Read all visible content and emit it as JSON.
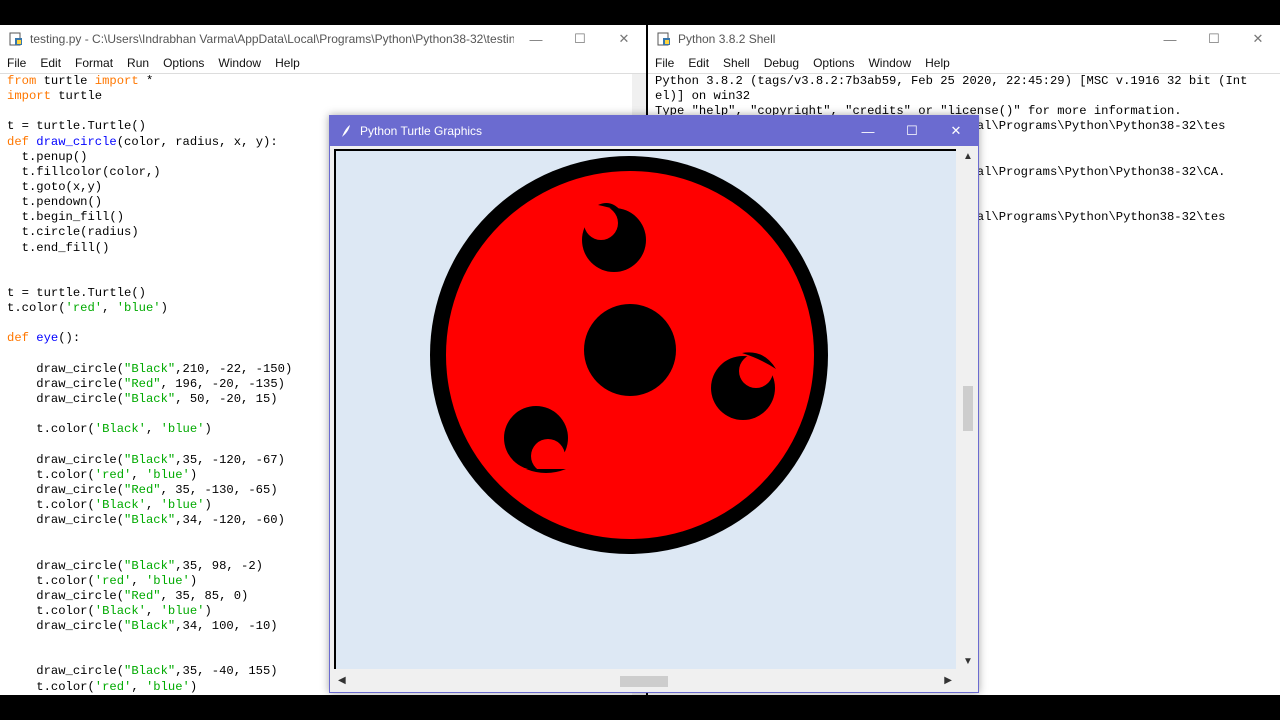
{
  "editor": {
    "title": "testing.py - C:\\Users\\Indrabhan Varma\\AppData\\Local\\Programs\\Python\\Python38-32\\testing....",
    "menu": [
      "File",
      "Edit",
      "Format",
      "Run",
      "Options",
      "Window",
      "Help"
    ],
    "code": [
      [
        [
          "from",
          "kw"
        ],
        [
          " turtle ",
          ""
        ],
        [
          "import",
          "kw"
        ],
        [
          " *",
          ""
        ]
      ],
      [
        [
          "import",
          "kw"
        ],
        [
          " turtle",
          ""
        ]
      ],
      [],
      [
        [
          "t = turtle.Turtle()",
          ""
        ]
      ],
      [
        [
          "def",
          "kw"
        ],
        [
          " ",
          ""
        ],
        [
          "draw_circle",
          "fn"
        ],
        [
          "(color, radius, x, y):",
          ""
        ]
      ],
      [
        [
          "  t.penup()",
          ""
        ]
      ],
      [
        [
          "  t.fillcolor(color,)",
          ""
        ]
      ],
      [
        [
          "  t.goto(x,y)",
          ""
        ]
      ],
      [
        [
          "  t.pendown()",
          ""
        ]
      ],
      [
        [
          "  t.begin_fill()",
          ""
        ]
      ],
      [
        [
          "  t.circle(radius)",
          ""
        ]
      ],
      [
        [
          "  t.end_fill()",
          ""
        ]
      ],
      [],
      [],
      [
        [
          "t = turtle.Turtle()",
          ""
        ]
      ],
      [
        [
          "t.color(",
          ""
        ],
        [
          "'red'",
          "str"
        ],
        [
          ", ",
          ""
        ],
        [
          "'blue'",
          "str"
        ],
        [
          ")",
          ""
        ]
      ],
      [],
      [
        [
          "def",
          "kw"
        ],
        [
          " ",
          ""
        ],
        [
          "eye",
          "fn"
        ],
        [
          "():",
          ""
        ]
      ],
      [],
      [
        [
          "    draw_circle(",
          ""
        ],
        [
          "\"Black\"",
          "str"
        ],
        [
          ",210, -22, -150)",
          ""
        ]
      ],
      [
        [
          "    draw_circle(",
          ""
        ],
        [
          "\"Red\"",
          "str"
        ],
        [
          ", 196, -20, -135)",
          ""
        ]
      ],
      [
        [
          "    draw_circle(",
          ""
        ],
        [
          "\"Black\"",
          "str"
        ],
        [
          ", 50, -20, 15)",
          ""
        ]
      ],
      [],
      [
        [
          "    t.color(",
          ""
        ],
        [
          "'Black'",
          "str"
        ],
        [
          ", ",
          ""
        ],
        [
          "'blue'",
          "str"
        ],
        [
          ")",
          ""
        ]
      ],
      [],
      [
        [
          "    draw_circle(",
          ""
        ],
        [
          "\"Black\"",
          "str"
        ],
        [
          ",35, -120, -67)",
          ""
        ]
      ],
      [
        [
          "    t.color(",
          ""
        ],
        [
          "'red'",
          "str"
        ],
        [
          ", ",
          ""
        ],
        [
          "'blue'",
          "str"
        ],
        [
          ")",
          ""
        ]
      ],
      [
        [
          "    draw_circle(",
          ""
        ],
        [
          "\"Red\"",
          "str"
        ],
        [
          ", 35, -130, -65)",
          ""
        ]
      ],
      [
        [
          "    t.color(",
          ""
        ],
        [
          "'Black'",
          "str"
        ],
        [
          ", ",
          ""
        ],
        [
          "'blue'",
          "str"
        ],
        [
          ")",
          ""
        ]
      ],
      [
        [
          "    draw_circle(",
          ""
        ],
        [
          "\"Black\"",
          "str"
        ],
        [
          ",34, -120, -60)",
          ""
        ]
      ],
      [],
      [],
      [
        [
          "    draw_circle(",
          ""
        ],
        [
          "\"Black\"",
          "str"
        ],
        [
          ",35, 98, -2)",
          ""
        ]
      ],
      [
        [
          "    t.color(",
          ""
        ],
        [
          "'red'",
          "str"
        ],
        [
          ", ",
          ""
        ],
        [
          "'blue'",
          "str"
        ],
        [
          ")",
          ""
        ]
      ],
      [
        [
          "    draw_circle(",
          ""
        ],
        [
          "\"Red\"",
          "str"
        ],
        [
          ", 35, 85, 0)",
          ""
        ]
      ],
      [
        [
          "    t.color(",
          ""
        ],
        [
          "'Black'",
          "str"
        ],
        [
          ", ",
          ""
        ],
        [
          "'blue'",
          "str"
        ],
        [
          ")",
          ""
        ]
      ],
      [
        [
          "    draw_circle(",
          ""
        ],
        [
          "\"Black\"",
          "str"
        ],
        [
          ",34, 100, -10)",
          ""
        ]
      ],
      [],
      [],
      [
        [
          "    draw_circle(",
          ""
        ],
        [
          "\"Black\"",
          "str"
        ],
        [
          ",35, -40, 155)",
          ""
        ]
      ],
      [
        [
          "    t.color(",
          ""
        ],
        [
          "'red'",
          "str"
        ],
        [
          ", ",
          ""
        ],
        [
          "'blue'",
          "str"
        ],
        [
          ")",
          ""
        ]
      ]
    ]
  },
  "shell": {
    "title": "Python 3.8.2 Shell",
    "menu": [
      "File",
      "Edit",
      "Shell",
      "Debug",
      "Options",
      "Window",
      "Help"
    ],
    "lines": [
      "Python 3.8.2 (tags/v3.8.2:7b3ab59, Feb 25 2020, 22:45:29) [MSC v.1916 32 bit (Int",
      "el)] on win32",
      "Type \"help\", \"copyright\", \"credits\" or \"license()\" for more information.",
      "                                        \\Local\\Programs\\Python\\Python38-32\\tes",
      "",
      "",
      "                                        \\Local\\Programs\\Python\\Python38-32\\CA.",
      "",
      "",
      "                                        \\Local\\Programs\\Python\\Python38-32\\tes"
    ]
  },
  "turtle": {
    "title": "Python Turtle Graphics",
    "colors": {
      "accent": "#6b6bd0",
      "canvas_bg": "#dde8f4",
      "red": "#ff0000",
      "black": "#000000"
    }
  }
}
